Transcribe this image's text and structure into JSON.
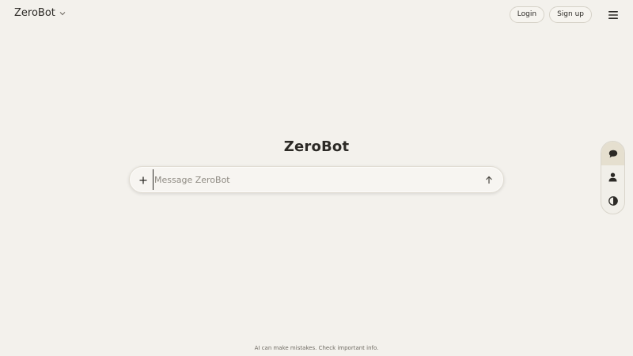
{
  "header": {
    "brand_name": "ZeroBot",
    "login_label": "Login",
    "signup_label": "Sign up"
  },
  "main": {
    "title": "ZeroBot",
    "composer": {
      "placeholder": "Message ZeroBot",
      "value": ""
    }
  },
  "rail": {
    "items": [
      {
        "icon": "chat-bubble-icon",
        "active": true
      },
      {
        "icon": "user-icon",
        "active": false
      },
      {
        "icon": "contrast-icon",
        "active": false
      }
    ]
  },
  "footer": {
    "disclaimer": "AI can make mistakes. Check important info."
  },
  "colors": {
    "background": "#f3f1ec",
    "text": "#2c2a26",
    "rail_active": "#e5dfcf"
  }
}
